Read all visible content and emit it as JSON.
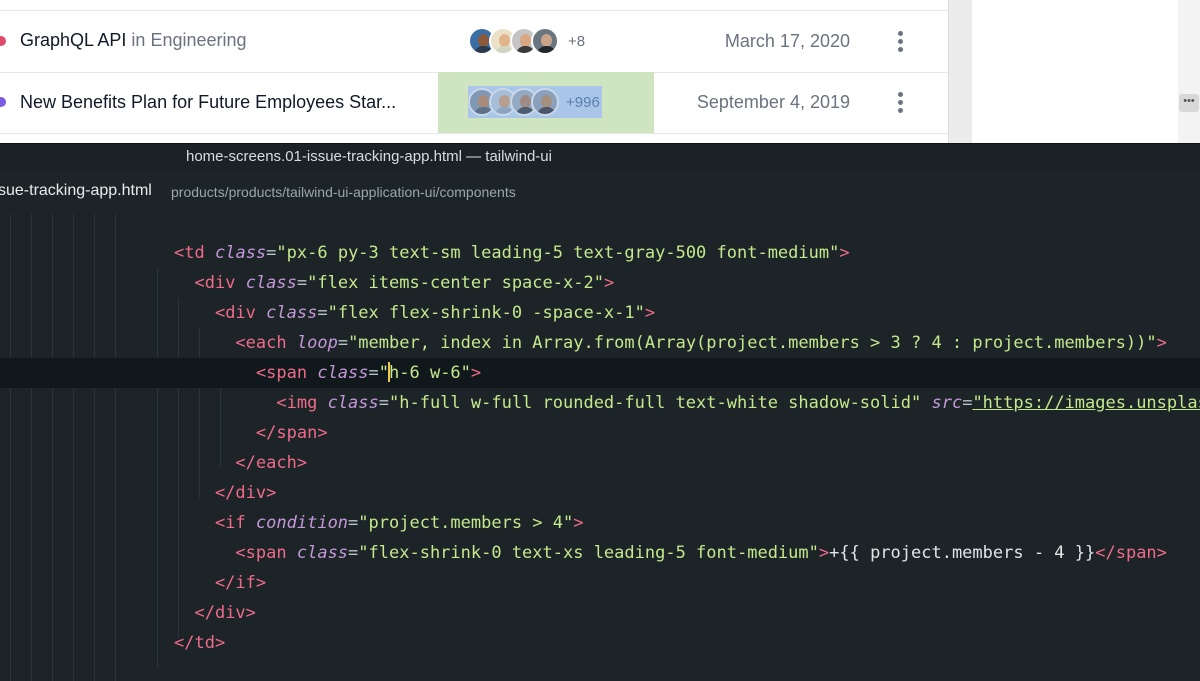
{
  "preview": {
    "rows": [
      {
        "project": "GraphQL API",
        "team_prefix": "in",
        "team": "Engineering",
        "dot_color": "#e04a6d",
        "more": "+8",
        "date": "March 17, 2020"
      },
      {
        "project": "New Benefits Plan for Future Employees Star...",
        "dot_color": "#7c5ce0",
        "more": "+996",
        "date": "September 4, 2019"
      }
    ],
    "overflow_button": "•••"
  },
  "editor": {
    "window_title": "home-screens.01-issue-tracking-app.html — tailwind-ui",
    "tab_file": "sue-tracking-app.html",
    "tab_path": "products/products/tailwind-ui-application-ui/components",
    "code": {
      "l1": {
        "tag": "td",
        "attr": "class",
        "val": "\"px-6 py-3 text-sm leading-5 text-gray-500 font-medium\""
      },
      "l2": {
        "tag": "div",
        "attr": "class",
        "val": "\"flex items-center space-x-2\""
      },
      "l3": {
        "tag": "div",
        "attr": "class",
        "val": "\"flex flex-shrink-0 -space-x-1\""
      },
      "l4": {
        "tag": "each",
        "attr": "loop",
        "val": "\"member, index in Array.from(Array(project.members > 3 ? 4 : project.members))\""
      },
      "l5": {
        "tag": "span",
        "attr": "class",
        "val_a": "\"",
        "val_b": "h-6 w-6\""
      },
      "l6": {
        "tag": "img",
        "attr": "class",
        "val": "\"h-full w-full rounded-full text-white shadow-solid\"",
        "attr2": "src",
        "val2": "\"https://images.unsplas"
      },
      "l7": {
        "tag": "span"
      },
      "l8": {
        "tag": "each"
      },
      "l9": {
        "tag": "div"
      },
      "l10": {
        "tag": "if",
        "attr": "condition",
        "val": "\"project.members > 4\""
      },
      "l11": {
        "tag": "span",
        "attr": "class",
        "val": "\"flex-shrink-0 text-xs leading-5 font-medium\"",
        "text": "+{{ project.members - 4 }}"
      },
      "l12": {
        "tag": "if"
      },
      "l13": {
        "tag": "div"
      },
      "l14": {
        "tag": "td"
      }
    }
  }
}
